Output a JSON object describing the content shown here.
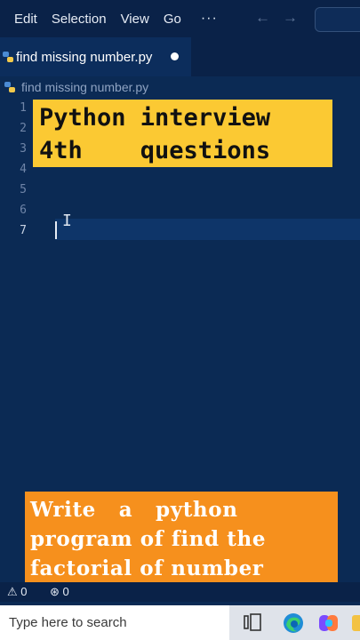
{
  "menu": {
    "items": [
      "Edit",
      "Selection",
      "View",
      "Go"
    ],
    "more_label": "···",
    "back_icon": "arrow-left-icon",
    "forward_icon": "arrow-right-icon"
  },
  "tab": {
    "title": "find missing number.py",
    "icon": "python-icon",
    "unsaved": true
  },
  "breadcrumb": {
    "file": "find missing number.py",
    "icon": "python-icon"
  },
  "editor": {
    "line_numbers": [
      "1",
      "2",
      "3",
      "4",
      "5",
      "6",
      "7"
    ],
    "active_line": "7"
  },
  "overlay": {
    "top_text": "Python interview\n4th    questions",
    "bottom_text": "Write   a   python\nprogram of find the\nfactorial of number"
  },
  "status": {
    "errors": "0",
    "ports": "0",
    "warning_icon": "warning-icon",
    "radio_icon": "broadcast-icon"
  },
  "taskbar": {
    "search_placeholder": "Type here to search",
    "icons": [
      "task-view-icon",
      "edge-icon",
      "copilot-icon",
      "app-icon"
    ]
  },
  "colors": {
    "editor_bg": "#0b2a54",
    "banner_yellow": "#fbc933",
    "banner_orange": "#f6901d"
  }
}
